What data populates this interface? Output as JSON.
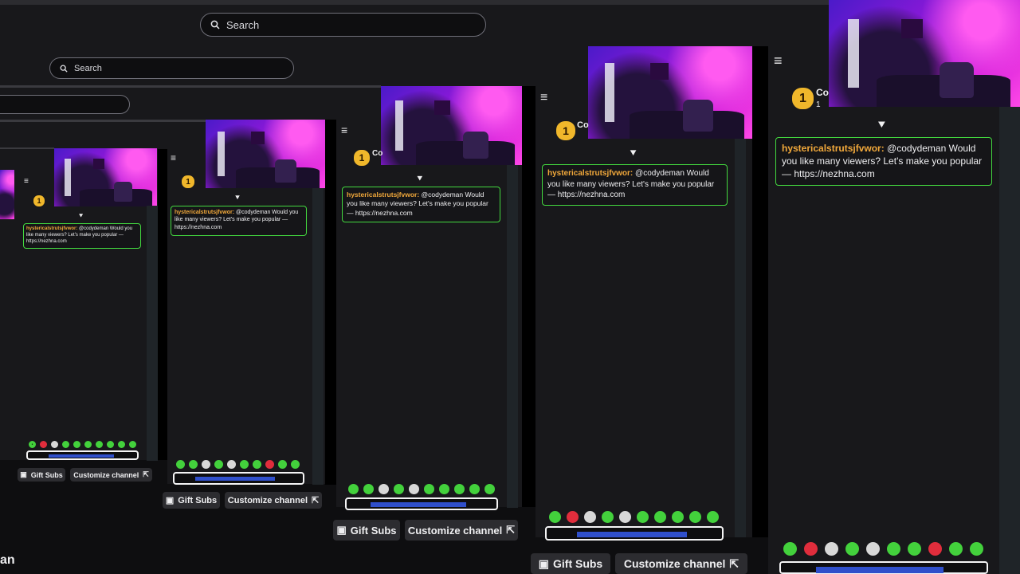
{
  "search": {
    "placeholder": "Search"
  },
  "message": {
    "username": "hystericalstrutsjfvwor:",
    "text": " @codydeman Would you like many viewers? Let's make you popular — https://nezhna.com"
  },
  "channel": {
    "badge_number": "1",
    "name_fragment": "Co",
    "sub_count": "1",
    "bottom_name_fragment": "an"
  },
  "buttons": {
    "gift_subs": "Gift Subs",
    "customize_channel": "Customize channel"
  },
  "icons": {
    "search": "search-icon",
    "gift": "gift-icon",
    "external_link": "external-link-icon",
    "collapse": "collapse-chat-icon",
    "chevron": "chevron-down-icon"
  },
  "colors": {
    "accent_green": "#43d93f",
    "username_orange": "#f2a93b",
    "badge_gold": "#f0b72b",
    "background": "#0e0e10"
  }
}
